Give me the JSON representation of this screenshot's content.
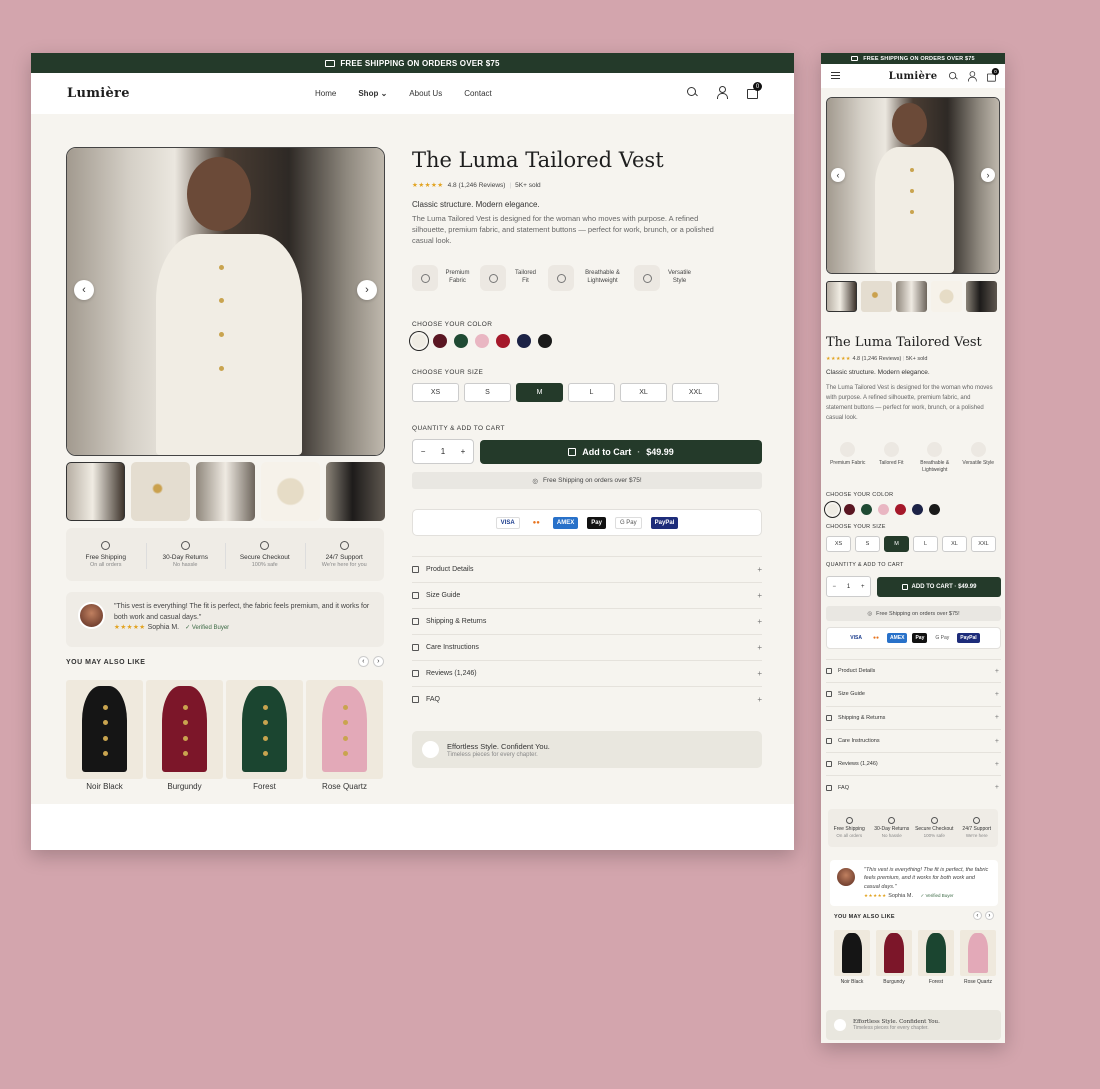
{
  "banner": {
    "text": "FREE SHIPPING ON ORDERS OVER $75"
  },
  "brand": {
    "logo": "Lumière"
  },
  "nav": {
    "home": "Home",
    "shop": "Shop",
    "about": "About Us",
    "contact": "Contact",
    "cart_count": "0"
  },
  "product": {
    "title": "The Luma Tailored Vest",
    "stars": "★★★★★",
    "rating": "4.8 (1,246 Reviews)",
    "sold": "5K+ sold",
    "tagline": "Classic structure. Modern elegance.",
    "description": "The Luma Tailored Vest is designed for the woman who moves with purpose. A refined silhouette, premium fabric, and statement buttons — perfect for work, brunch, or a polished casual look."
  },
  "features": [
    "Premium Fabric",
    "Tailored Fit",
    "Breathable & Lightweight",
    "Versatile Style"
  ],
  "mobile_features": [
    "Premium Fabric",
    "Tailored Fit",
    "Breathable & Lightweight",
    "Versatile Style"
  ],
  "color_label": "CHOOSE YOUR COLOR",
  "colors": [
    "#efece4",
    "#5a1622",
    "#1f4a33",
    "#e9b6c2",
    "#a5182a",
    "#1c2246",
    "#1a1a1a"
  ],
  "size_label": "CHOOSE YOUR SIZE",
  "sizes": [
    "XS",
    "S",
    "M",
    "L",
    "XL",
    "XXL"
  ],
  "selected_size": "M",
  "qty_label": "QUANTITY & ADD TO CART",
  "quantity": {
    "minus": "−",
    "value": "1",
    "plus": "+"
  },
  "add_to_cart": {
    "label": "Add to Cart",
    "sep": "·",
    "price": "$49.99"
  },
  "mobile_add_to_cart": "ADD TO CART · $49.99",
  "shipping_note": "Free Shipping on orders over $75!",
  "payments": [
    "VISA",
    "●●",
    "AMEX",
    "Pay",
    "G Pay",
    "PayPal"
  ],
  "accordion": [
    "Product Details",
    "Size Guide",
    "Shipping & Returns",
    "Care Instructions",
    "Reviews (1,246)",
    "FAQ"
  ],
  "trust": [
    {
      "title": "Free Shipping",
      "sub": "On all orders"
    },
    {
      "title": "30-Day Returns",
      "sub": "No hassle"
    },
    {
      "title": "Secure Checkout",
      "sub": "100% safe"
    },
    {
      "title": "24/7 Support",
      "sub": "We're here for you"
    }
  ],
  "mobile_trust": [
    {
      "title": "Free Shipping",
      "sub": "On all orders"
    },
    {
      "title": "30-Day Returns",
      "sub": "No hassle"
    },
    {
      "title": "Secure Checkout",
      "sub": "100% safe"
    },
    {
      "title": "24/7 Support",
      "sub": "We're here"
    }
  ],
  "review": {
    "quote": "\"This vest is everything! The fit is perfect, the fabric feels premium, and it works for both work and casual days.\"",
    "stars": "★★★★★",
    "author": "Sophia M.",
    "verified": "✓ Verified Buyer"
  },
  "related_title": "YOU MAY ALSO LIKE",
  "related": [
    {
      "name": "Noir Black",
      "color": "#151515"
    },
    {
      "name": "Burgundy",
      "color": "#7c1629"
    },
    {
      "name": "Forest",
      "color": "#1b4530"
    },
    {
      "name": "Rose Quartz",
      "color": "#e3a9b8"
    }
  ],
  "promo": {
    "title": "Effortless Style. Confident You.",
    "sub": "Timeless pieces for every chapter."
  }
}
